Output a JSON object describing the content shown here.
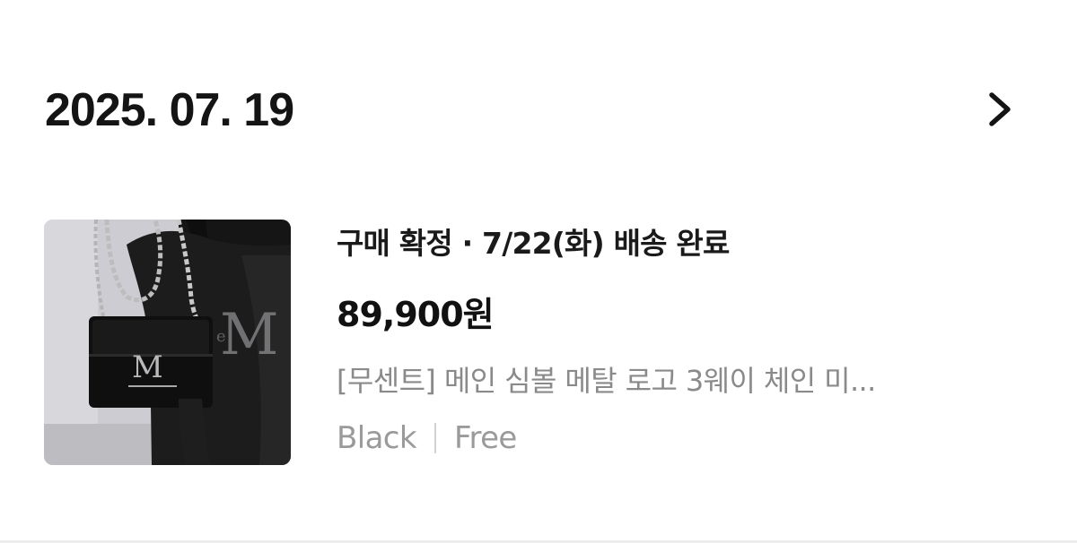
{
  "order": {
    "date": "2025. 07. 19",
    "status_line": "구매 확정 · 7/22(화) 배송 완료",
    "price": "89,900원",
    "product_name": "[무센트] 메인 심볼 메탈 로고 3웨이 체인 미...",
    "options": {
      "color": "Black",
      "size": "Free"
    },
    "product_image_alt": "black chain crossbody bag with metal M logo"
  },
  "icons": {
    "detail": "chevron-right-icon"
  },
  "colors": {
    "text_primary": "#111111",
    "text_secondary": "#8a8a8a",
    "divider": "#ececec"
  }
}
